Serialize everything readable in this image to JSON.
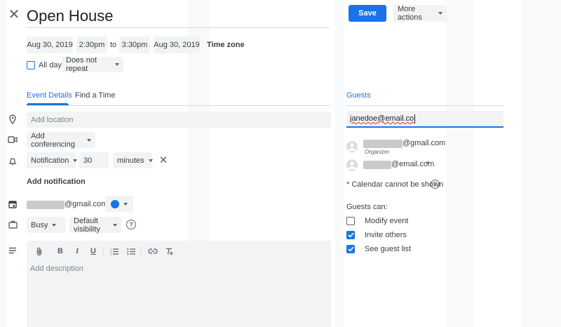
{
  "event": {
    "title": "Open House",
    "start_date": "Aug 30, 2019",
    "start_time": "2:30pm",
    "to_label": "to",
    "end_time": "3:30pm",
    "end_date": "Aug 30, 2019",
    "time_zone_label": "Time zone",
    "all_day_label": "All day",
    "repeat_value": "Does not repeat"
  },
  "actions": {
    "save_label": "Save",
    "more_actions_label": "More actions"
  },
  "tabs": [
    {
      "label": "Event Details",
      "active": true
    },
    {
      "label": "Find a Time",
      "active": false
    }
  ],
  "details": {
    "location_placeholder": "Add location",
    "conferencing_label": "Add conferencing",
    "notification_type": "Notification",
    "notification_value": "30",
    "notification_unit": "minutes",
    "add_notification_label": "Add notification",
    "calendar_suffix": "@gmail.com",
    "calendar_color": "#1a73e8",
    "busy_value": "Busy",
    "visibility_value": "Default visibility",
    "description_placeholder": "Add description"
  },
  "guests": {
    "title": "Guests",
    "input_value": "janedoe@email.co",
    "list": [
      {
        "email_suffix": "@gmail.com",
        "role": "Organizer",
        "marker": ""
      },
      {
        "email_suffix": "@email.com",
        "role": "",
        "marker": "*"
      }
    ],
    "calendar_note": "* Calendar cannot be shown",
    "permissions_title": "Guests can:",
    "permissions": [
      {
        "label": "Modify event",
        "checked": false
      },
      {
        "label": "Invite others",
        "checked": true
      },
      {
        "label": "See guest list",
        "checked": true
      }
    ]
  },
  "colors": {
    "accent": "#1a73e8",
    "field_bg": "#f1f3f4"
  }
}
